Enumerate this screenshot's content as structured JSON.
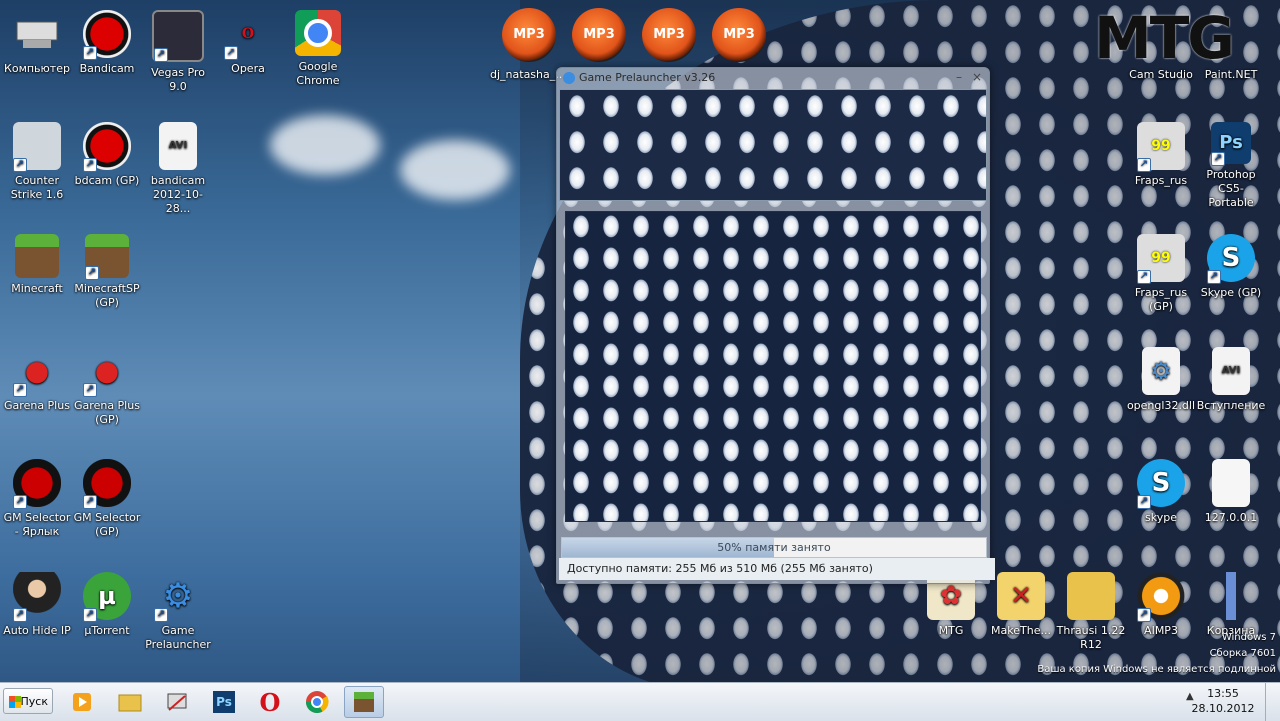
{
  "desktop_icons": [
    {
      "label": "Компьютер"
    },
    {
      "label": "Bandicam"
    },
    {
      "label": "Vegas Pro 9.0"
    },
    {
      "label": "Opera"
    },
    {
      "label": "Google Chrome"
    },
    {
      "label": "Counter Strike 1.6"
    },
    {
      "label": "bdcam (GP)"
    },
    {
      "label": "bandicam 2012-10-28..."
    },
    {
      "label": "Minecraft"
    },
    {
      "label": "MinecraftSP (GP)"
    },
    {
      "label": "Garena Plus"
    },
    {
      "label": "Garena Plus (GP)"
    },
    {
      "label": "GM Selector - Ярлык"
    },
    {
      "label": "GM Selector (GP)"
    },
    {
      "label": "Auto Hide IP"
    },
    {
      "label": "µTorrent"
    },
    {
      "label": "Game Prelauncher"
    },
    {
      "label": "dj_natasha_..."
    },
    {
      "label": "Cam Studio"
    },
    {
      "label": "Paint.NET"
    },
    {
      "label": "Fraps_rus"
    },
    {
      "label": "Protohop CS5-Portable"
    },
    {
      "label": "Fraps_rus (GP)"
    },
    {
      "label": "Skype (GP)"
    },
    {
      "label": "opengl32.dll"
    },
    {
      "label": "Вступление"
    },
    {
      "label": "skype"
    },
    {
      "label": "127.0.0.1"
    },
    {
      "label": "MTG"
    },
    {
      "label": "MakeThe..."
    },
    {
      "label": "Thrausi 1.22 R12"
    },
    {
      "label": "AIMP3"
    },
    {
      "label": "Корзина"
    }
  ],
  "mp3_badge": "MP3",
  "window": {
    "title": "Game Prelauncher  v3.26",
    "minimize": "–",
    "close": "×",
    "progress_text": "50% памяти занято",
    "progress_value": 0.5,
    "status_text": "Доступно памяти: 255 Мб из 510 Мб (255 Мб занято)"
  },
  "watermark": {
    "logo": "MTG",
    "line1": "Windows 7",
    "line2": "Сборка 7601",
    "line3": "Ваша копия Windows не является подлинной"
  },
  "taskbar": {
    "start_label": "Пуск",
    "time": "13:55",
    "date": "28.10.2012",
    "ps_label": "Ps"
  }
}
